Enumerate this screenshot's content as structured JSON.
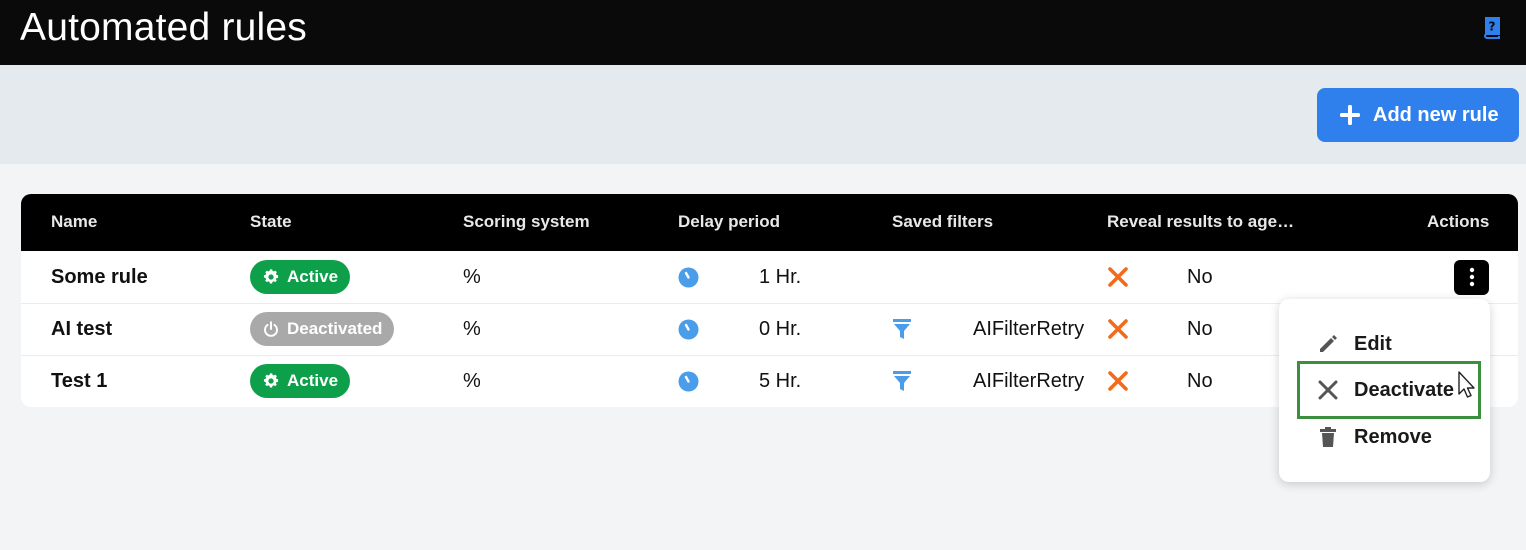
{
  "header": {
    "title": "Automated rules"
  },
  "toolbar": {
    "add_label": "Add new rule"
  },
  "table": {
    "columns": [
      "Name",
      "State",
      "Scoring system",
      "Delay period",
      "Saved filters",
      "Reveal results to age…",
      "Actions"
    ],
    "rows": [
      {
        "name": "Some rule",
        "state": "Active",
        "scoring": "%",
        "delay": "1 Hr.",
        "filter": "",
        "reveal": "No"
      },
      {
        "name": "AI test",
        "state": "Deactivated",
        "scoring": "%",
        "delay": "0 Hr.",
        "filter": "AIFilterRetry",
        "reveal": "No"
      },
      {
        "name": "Test 1",
        "state": "Active",
        "scoring": "%",
        "delay": "5 Hr.",
        "filter": "AIFilterRetry",
        "reveal": "No"
      }
    ]
  },
  "menu": {
    "edit": "Edit",
    "deactivate": "Deactivate",
    "remove": "Remove"
  },
  "colors": {
    "accent": "#2f80ed",
    "active": "#0e9f4a",
    "inactive": "#a9a9a9",
    "reveal_x": "#f26b1d",
    "highlight": "#3b8f3e"
  }
}
